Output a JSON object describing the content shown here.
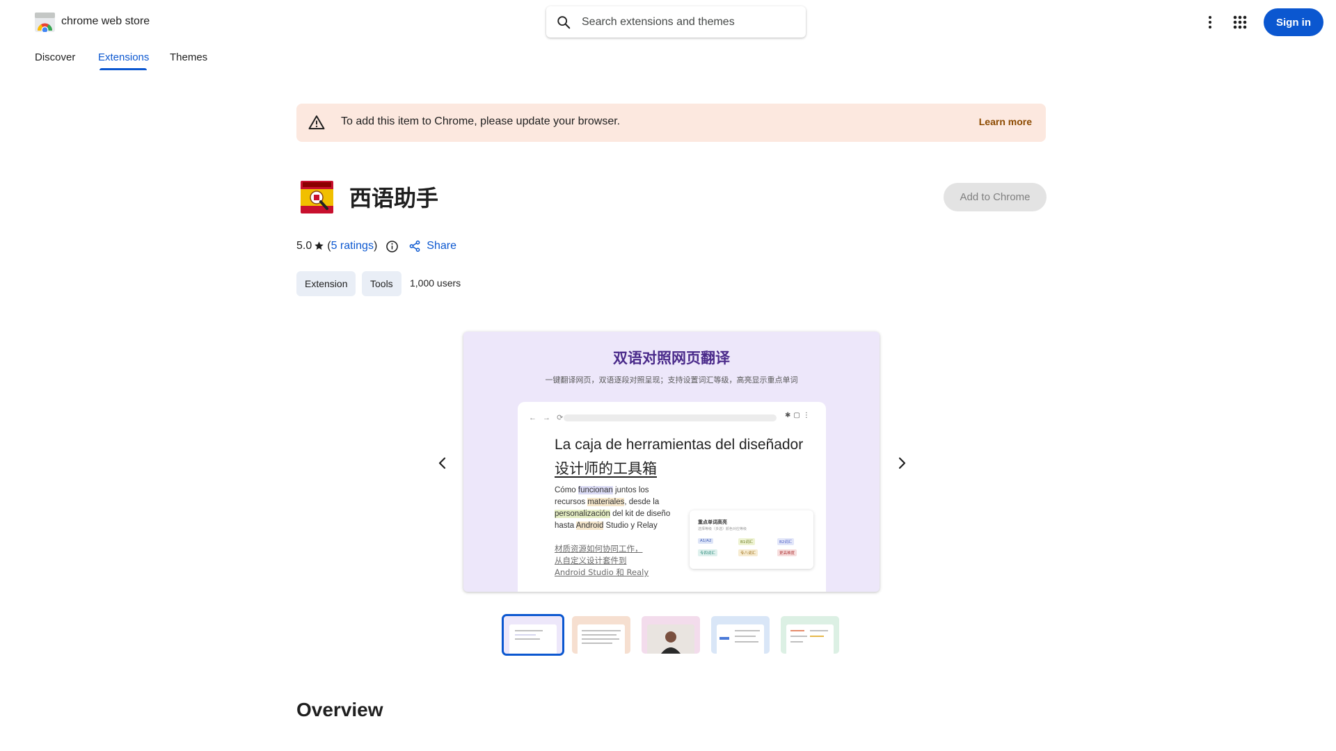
{
  "header": {
    "brand": "chrome web store",
    "search_placeholder": "Search extensions and themes",
    "sign_in_label": "Sign in"
  },
  "nav": {
    "tabs": [
      {
        "label": "Discover",
        "active": false
      },
      {
        "label": "Extensions",
        "active": true
      },
      {
        "label": "Themes",
        "active": false
      }
    ]
  },
  "banner": {
    "message": "To add this item to Chrome, please update your browser.",
    "link": "Learn more",
    "icon": "warning-icon"
  },
  "extension": {
    "title": "西语助手",
    "add_button": "Add to Chrome",
    "rating": "5.0",
    "ratings_link": "5 ratings",
    "share_label": "Share",
    "chips": [
      "Extension",
      "Tools"
    ],
    "users": "1,000 users"
  },
  "screenshot": {
    "title": "双语对照网页翻译",
    "subtitle": "一键翻译网页，双语逐段对照呈现；支持设置词汇等级，高亮显示重点单词",
    "heading_es": "La caja de herramientas del diseñador",
    "heading_zh": "设计师的工具箱",
    "paragraph_zh_1": "材质资源如何协同工作，",
    "paragraph_zh_2": "从自定义设计套件到",
    "paragraph_zh_3": "Android Studio 和 Realy",
    "card_title": "重点单词高亮",
    "card_sub": "选择等级（多选）颜色对应等级"
  },
  "thumbnails": {
    "count": 5,
    "selected_index": 0,
    "colors": [
      "#ede7fa",
      "#f6dfd0",
      "#f3dcec",
      "#d9e6f7",
      "#dcf0e4"
    ]
  },
  "overview_title": "Overview",
  "colors": {
    "accent": "#0b57d0",
    "banner_bg": "#fce8df",
    "chip_bg": "#e9eef6"
  }
}
